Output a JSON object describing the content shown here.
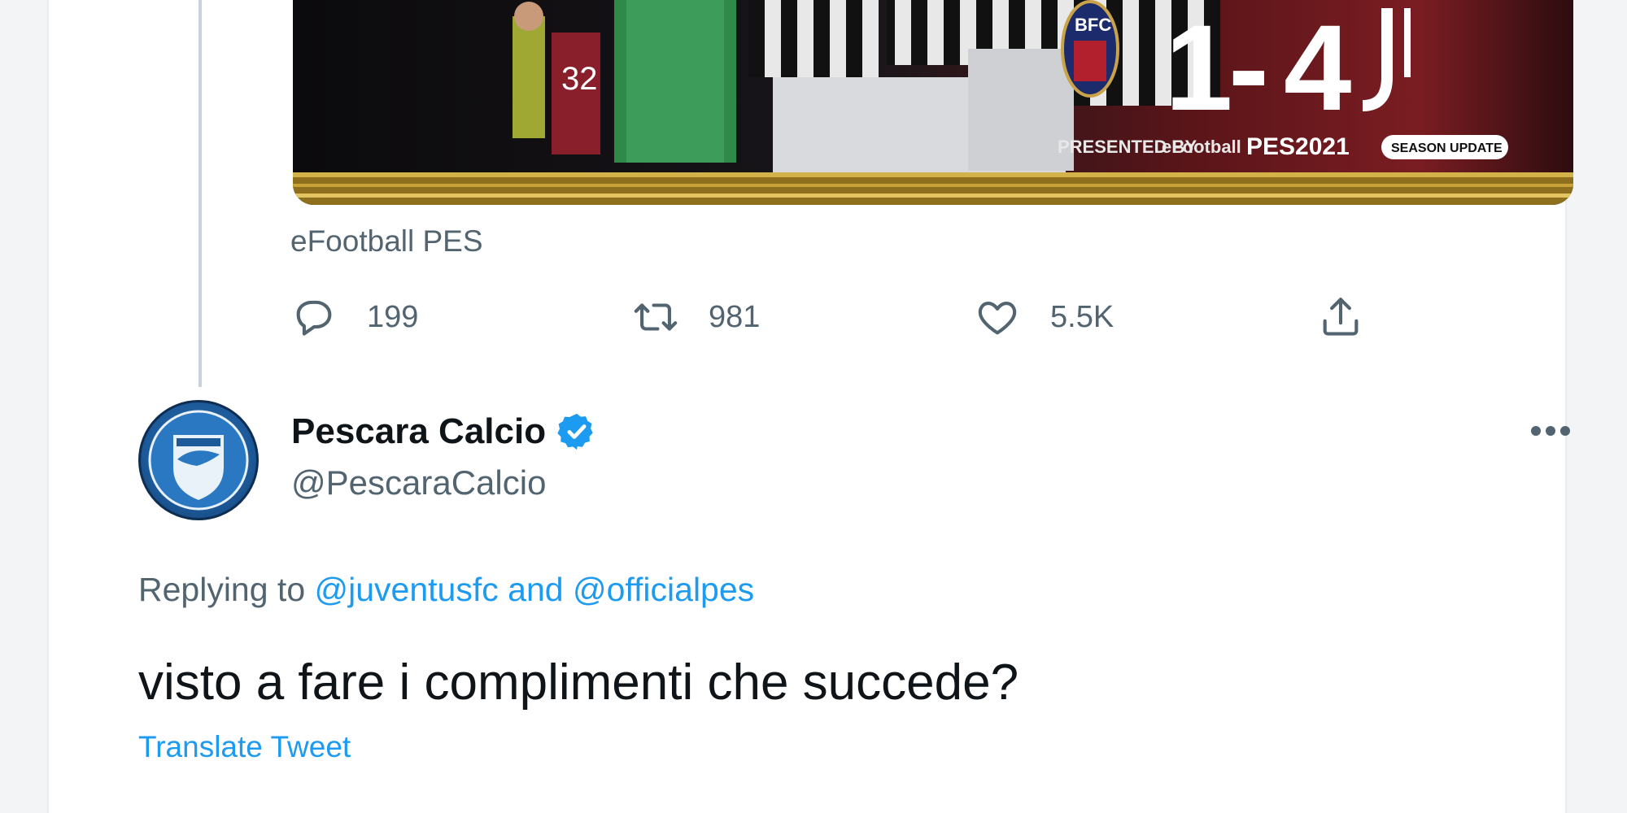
{
  "media": {
    "score_home": "1",
    "score_sep": "-",
    "score_away": "4",
    "crest_text": "BFC",
    "jersey_number": "32",
    "sponsor_line": "PRESENTED BY",
    "sponsor_brand": "eFootball",
    "game_name": "PES2021",
    "badge": "SEASON UPDATE"
  },
  "source_label": "eFootball PES",
  "actions": {
    "reply_count": "199",
    "retweet_count": "981",
    "like_count": "5.5K"
  },
  "reply": {
    "name": "Pescara Calcio",
    "handle": "@PescaraCalcio",
    "replying_prefix": "Replying to ",
    "mention_1": "@juventusfc",
    "mention_joiner": " and ",
    "mention_2": "@officialpes",
    "text": "visto a fare i complimenti che succede?",
    "translate": "Translate Tweet"
  },
  "colors": {
    "link": "#1d9bf0",
    "muted": "#536471",
    "verified": "#1d9bf0"
  },
  "icons": {
    "reply": "speech-bubble-icon",
    "retweet": "retweet-icon",
    "like": "heart-icon",
    "share": "share-icon",
    "more": "more-horizontal-icon",
    "verified": "verified-badge-icon"
  }
}
